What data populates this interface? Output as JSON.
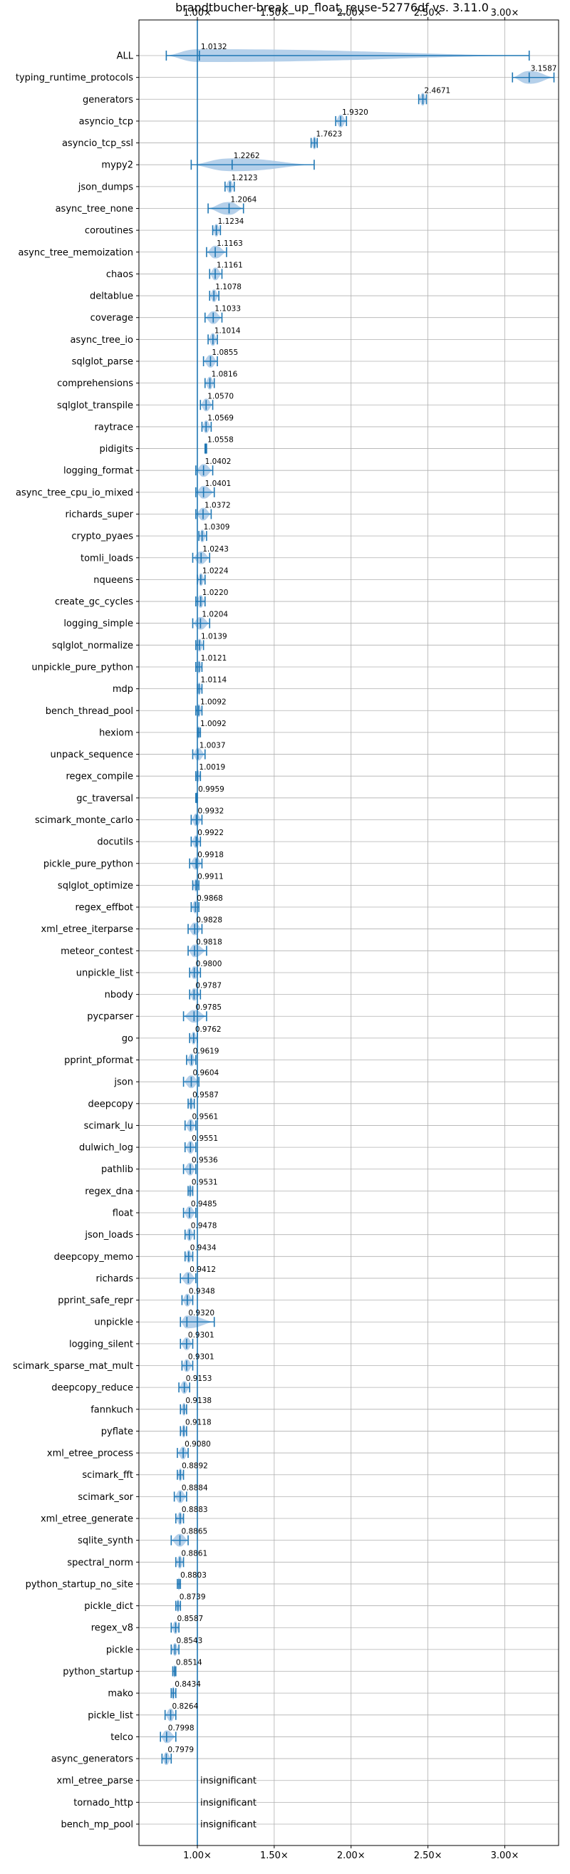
{
  "chart_data": {
    "type": "violin",
    "orientation": "horizontal",
    "title": "brandtbucher-break_up_float_reuse-52776df vs. 3.11.0",
    "xlabel": "",
    "ylabel": "",
    "x_ticks": [
      1.0,
      1.5,
      2.0,
      2.5,
      3.0
    ],
    "x_tick_labels": [
      "1.00×",
      "1.50×",
      "2.00×",
      "2.50×",
      "3.00×"
    ],
    "xlim": [
      0.62,
      3.35
    ],
    "reference_line": 1.0,
    "grid": "horizontal",
    "colors": {
      "violin": "#a8c8e6",
      "line": "#1f77b4"
    },
    "series": [
      {
        "name": "ALL",
        "value": 1.0132,
        "min": 0.7979,
        "max": 3.1587
      },
      {
        "name": "typing_runtime_protocols",
        "value": 3.1587,
        "min": 3.05,
        "max": 3.32
      },
      {
        "name": "generators",
        "value": 2.4671,
        "min": 2.44,
        "max": 2.49
      },
      {
        "name": "asyncio_tcp",
        "value": 1.932,
        "min": 1.9,
        "max": 1.97
      },
      {
        "name": "asyncio_tcp_ssl",
        "value": 1.7623,
        "min": 1.74,
        "max": 1.78
      },
      {
        "name": "mypy2",
        "value": 1.2262,
        "min": 0.96,
        "max": 1.76
      },
      {
        "name": "json_dumps",
        "value": 1.2123,
        "min": 1.18,
        "max": 1.24
      },
      {
        "name": "async_tree_none",
        "value": 1.2064,
        "min": 1.07,
        "max": 1.3
      },
      {
        "name": "coroutines",
        "value": 1.1234,
        "min": 1.1,
        "max": 1.15
      },
      {
        "name": "async_tree_memoization",
        "value": 1.1163,
        "min": 1.06,
        "max": 1.19
      },
      {
        "name": "chaos",
        "value": 1.1161,
        "min": 1.08,
        "max": 1.16
      },
      {
        "name": "deltablue",
        "value": 1.1078,
        "min": 1.08,
        "max": 1.14
      },
      {
        "name": "coverage",
        "value": 1.1033,
        "min": 1.05,
        "max": 1.16
      },
      {
        "name": "async_tree_io",
        "value": 1.1014,
        "min": 1.07,
        "max": 1.13
      },
      {
        "name": "sqlglot_parse",
        "value": 1.0855,
        "min": 1.04,
        "max": 1.13
      },
      {
        "name": "comprehensions",
        "value": 1.0816,
        "min": 1.05,
        "max": 1.11
      },
      {
        "name": "sqlglot_transpile",
        "value": 1.057,
        "min": 1.02,
        "max": 1.1
      },
      {
        "name": "raytrace",
        "value": 1.0569,
        "min": 1.03,
        "max": 1.09
      },
      {
        "name": "pidigits",
        "value": 1.0558,
        "min": 1.05,
        "max": 1.06
      },
      {
        "name": "logging_format",
        "value": 1.0402,
        "min": 0.99,
        "max": 1.1
      },
      {
        "name": "async_tree_cpu_io_mixed",
        "value": 1.0401,
        "min": 0.99,
        "max": 1.11
      },
      {
        "name": "richards_super",
        "value": 1.0372,
        "min": 0.99,
        "max": 1.09
      },
      {
        "name": "crypto_pyaes",
        "value": 1.0309,
        "min": 1.01,
        "max": 1.06
      },
      {
        "name": "tomli_loads",
        "value": 1.0243,
        "min": 0.97,
        "max": 1.08
      },
      {
        "name": "nqueens",
        "value": 1.0224,
        "min": 1.0,
        "max": 1.05
      },
      {
        "name": "create_gc_cycles",
        "value": 1.022,
        "min": 0.99,
        "max": 1.05
      },
      {
        "name": "logging_simple",
        "value": 1.0204,
        "min": 0.97,
        "max": 1.08
      },
      {
        "name": "sqlglot_normalize",
        "value": 1.0139,
        "min": 0.99,
        "max": 1.04
      },
      {
        "name": "unpickle_pure_python",
        "value": 1.0121,
        "min": 0.99,
        "max": 1.03
      },
      {
        "name": "mdp",
        "value": 1.0114,
        "min": 1.0,
        "max": 1.03
      },
      {
        "name": "bench_thread_pool",
        "value": 1.0092,
        "min": 0.99,
        "max": 1.03
      },
      {
        "name": "hexiom",
        "value": 1.0092,
        "min": 1.0,
        "max": 1.02
      },
      {
        "name": "unpack_sequence",
        "value": 1.0037,
        "min": 0.97,
        "max": 1.05
      },
      {
        "name": "regex_compile",
        "value": 1.0019,
        "min": 0.99,
        "max": 1.02
      },
      {
        "name": "gc_traversal",
        "value": 0.9959,
        "min": 0.99,
        "max": 1.0
      },
      {
        "name": "scimark_monte_carlo",
        "value": 0.9932,
        "min": 0.96,
        "max": 1.03
      },
      {
        "name": "docutils",
        "value": 0.9922,
        "min": 0.96,
        "max": 1.02
      },
      {
        "name": "pickle_pure_python",
        "value": 0.9918,
        "min": 0.95,
        "max": 1.03
      },
      {
        "name": "sqlglot_optimize",
        "value": 0.9911,
        "min": 0.97,
        "max": 1.01
      },
      {
        "name": "regex_effbot",
        "value": 0.9868,
        "min": 0.96,
        "max": 1.01
      },
      {
        "name": "xml_etree_iterparse",
        "value": 0.9828,
        "min": 0.94,
        "max": 1.03
      },
      {
        "name": "meteor_contest",
        "value": 0.9818,
        "min": 0.94,
        "max": 1.06
      },
      {
        "name": "unpickle_list",
        "value": 0.98,
        "min": 0.95,
        "max": 1.02
      },
      {
        "name": "nbody",
        "value": 0.9787,
        "min": 0.95,
        "max": 1.02
      },
      {
        "name": "pycparser",
        "value": 0.9785,
        "min": 0.91,
        "max": 1.06
      },
      {
        "name": "go",
        "value": 0.9762,
        "min": 0.95,
        "max": 1.0
      },
      {
        "name": "pprint_pformat",
        "value": 0.9619,
        "min": 0.93,
        "max": 0.99
      },
      {
        "name": "json",
        "value": 0.9604,
        "min": 0.91,
        "max": 1.01
      },
      {
        "name": "deepcopy",
        "value": 0.9587,
        "min": 0.94,
        "max": 0.98
      },
      {
        "name": "scimark_lu",
        "value": 0.9561,
        "min": 0.92,
        "max": 0.99
      },
      {
        "name": "dulwich_log",
        "value": 0.9551,
        "min": 0.92,
        "max": 0.99
      },
      {
        "name": "pathlib",
        "value": 0.9536,
        "min": 0.91,
        "max": 0.99
      },
      {
        "name": "regex_dna",
        "value": 0.9531,
        "min": 0.94,
        "max": 0.97
      },
      {
        "name": "float",
        "value": 0.9485,
        "min": 0.91,
        "max": 0.99
      },
      {
        "name": "json_loads",
        "value": 0.9478,
        "min": 0.92,
        "max": 0.98
      },
      {
        "name": "deepcopy_memo",
        "value": 0.9434,
        "min": 0.92,
        "max": 0.97
      },
      {
        "name": "richards",
        "value": 0.9412,
        "min": 0.89,
        "max": 0.99
      },
      {
        "name": "pprint_safe_repr",
        "value": 0.9348,
        "min": 0.9,
        "max": 0.97
      },
      {
        "name": "unpickle",
        "value": 0.932,
        "min": 0.89,
        "max": 1.11
      },
      {
        "name": "logging_silent",
        "value": 0.9301,
        "min": 0.89,
        "max": 0.97
      },
      {
        "name": "scimark_sparse_mat_mult",
        "value": 0.9301,
        "min": 0.9,
        "max": 0.97
      },
      {
        "name": "deepcopy_reduce",
        "value": 0.9153,
        "min": 0.88,
        "max": 0.95
      },
      {
        "name": "fannkuch",
        "value": 0.9138,
        "min": 0.89,
        "max": 0.93
      },
      {
        "name": "pyflate",
        "value": 0.9118,
        "min": 0.89,
        "max": 0.93
      },
      {
        "name": "xml_etree_process",
        "value": 0.908,
        "min": 0.87,
        "max": 0.94
      },
      {
        "name": "scimark_fft",
        "value": 0.8892,
        "min": 0.87,
        "max": 0.91
      },
      {
        "name": "scimark_sor",
        "value": 0.8884,
        "min": 0.85,
        "max": 0.93
      },
      {
        "name": "xml_etree_generate",
        "value": 0.8883,
        "min": 0.86,
        "max": 0.91
      },
      {
        "name": "sqlite_synth",
        "value": 0.8865,
        "min": 0.83,
        "max": 0.94
      },
      {
        "name": "spectral_norm",
        "value": 0.8861,
        "min": 0.86,
        "max": 0.91
      },
      {
        "name": "python_startup_no_site",
        "value": 0.8803,
        "min": 0.87,
        "max": 0.89
      },
      {
        "name": "pickle_dict",
        "value": 0.8739,
        "min": 0.86,
        "max": 0.89
      },
      {
        "name": "regex_v8",
        "value": 0.8587,
        "min": 0.83,
        "max": 0.88
      },
      {
        "name": "pickle",
        "value": 0.8543,
        "min": 0.83,
        "max": 0.88
      },
      {
        "name": "python_startup",
        "value": 0.8514,
        "min": 0.84,
        "max": 0.86
      },
      {
        "name": "mako",
        "value": 0.8434,
        "min": 0.83,
        "max": 0.86
      },
      {
        "name": "pickle_list",
        "value": 0.8264,
        "min": 0.79,
        "max": 0.86
      },
      {
        "name": "telco",
        "value": 0.7998,
        "min": 0.76,
        "max": 0.86
      },
      {
        "name": "async_generators",
        "value": 0.7979,
        "min": 0.77,
        "max": 0.83
      },
      {
        "name": "xml_etree_parse",
        "value": null,
        "note": "insignificant"
      },
      {
        "name": "tornado_http",
        "value": null,
        "note": "insignificant"
      },
      {
        "name": "bench_mp_pool",
        "value": null,
        "note": "insignificant"
      }
    ]
  }
}
